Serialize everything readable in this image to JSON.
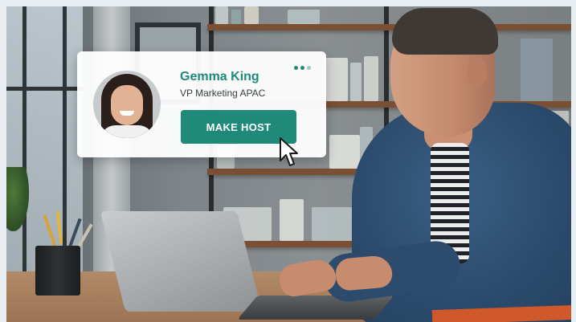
{
  "card": {
    "name": "Gemma King",
    "role": "VP Marketing APAC",
    "action_label": "MAKE HOST",
    "more_icon": "more-dots-icon",
    "avatar_icon": "user-avatar"
  },
  "colors": {
    "accent": "#1f8a7a",
    "name_text": "#1e8a79",
    "dot_1": "#1e8a79",
    "dot_2": "#1e8a79",
    "dot_3": "#9fc9c2"
  },
  "cursor": {
    "icon": "mouse-pointer-icon"
  }
}
